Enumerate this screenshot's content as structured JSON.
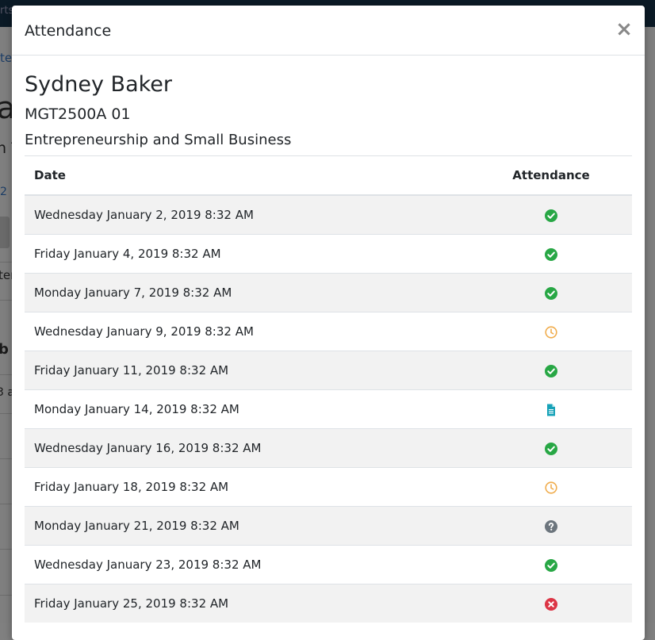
{
  "modal": {
    "title": "Attendance",
    "close_label": "×",
    "student_name": "Sydney Baker",
    "course_code": "MGT2500A 01",
    "course_name": "Entrepreneurship and Small Business"
  },
  "table": {
    "headers": {
      "date": "Date",
      "attendance": "Attendance"
    },
    "rows": [
      {
        "date": "Wednesday January 2, 2019 8:32 AM",
        "status": "present",
        "icon": "check-circle-icon"
      },
      {
        "date": "Friday January 4, 2019 8:32 AM",
        "status": "present",
        "icon": "check-circle-icon"
      },
      {
        "date": "Monday January 7, 2019 8:32 AM",
        "status": "present",
        "icon": "check-circle-icon"
      },
      {
        "date": "Wednesday January 9, 2019 8:32 AM",
        "status": "late",
        "icon": "clock-icon"
      },
      {
        "date": "Friday January 11, 2019 8:32 AM",
        "status": "present",
        "icon": "check-circle-icon"
      },
      {
        "date": "Monday January 14, 2019 8:32 AM",
        "status": "excused",
        "icon": "document-icon"
      },
      {
        "date": "Wednesday January 16, 2019 8:32 AM",
        "status": "present",
        "icon": "check-circle-icon"
      },
      {
        "date": "Friday January 18, 2019 8:32 AM",
        "status": "late",
        "icon": "clock-icon"
      },
      {
        "date": "Monday January 21, 2019 8:32 AM",
        "status": "unknown",
        "icon": "question-circle-icon"
      },
      {
        "date": "Wednesday January 23, 2019 8:32 AM",
        "status": "present",
        "icon": "check-circle-icon"
      },
      {
        "date": "Friday January 25, 2019 8:32 AM",
        "status": "absent",
        "icon": "times-circle-icon"
      }
    ]
  },
  "status_colors": {
    "present": "#28a745",
    "late": "#f0ad4e",
    "excused": "#17a2b8",
    "unknown": "#6c757d",
    "absent": "#dc3545"
  },
  "background": {
    "fragments": [
      "rts",
      "te",
      "a",
      "n T",
      "2",
      "ter",
      "b a",
      "3 a"
    ]
  }
}
